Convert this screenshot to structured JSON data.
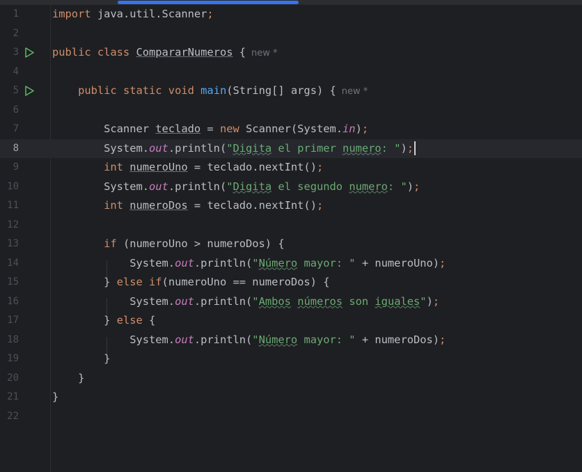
{
  "editor": {
    "language": "java",
    "current_line": 8,
    "class_name": "CompararNumeros",
    "inlay_hint": "new *",
    "lines": [
      {
        "n": "1"
      },
      {
        "n": "2"
      },
      {
        "n": "3"
      },
      {
        "n": "4"
      },
      {
        "n": "5"
      },
      {
        "n": "6"
      },
      {
        "n": "7"
      },
      {
        "n": "8"
      },
      {
        "n": "9"
      },
      {
        "n": "10"
      },
      {
        "n": "11"
      },
      {
        "n": "12"
      },
      {
        "n": "13"
      },
      {
        "n": "14"
      },
      {
        "n": "15"
      },
      {
        "n": "16"
      },
      {
        "n": "17"
      },
      {
        "n": "18"
      },
      {
        "n": "19"
      },
      {
        "n": "20"
      },
      {
        "n": "21"
      },
      {
        "n": "22"
      }
    ],
    "colors": {
      "background": "#1e1f22",
      "keyword": "#cf8e6d",
      "string": "#6aab73",
      "static_field": "#c77dbb",
      "method_decl": "#56a8f5",
      "text": "#bcbec4",
      "run_icon": "#5fb865",
      "scrollbar": "#3574f0"
    },
    "icons": {
      "run_gutter": "run-triangle-icon"
    }
  }
}
